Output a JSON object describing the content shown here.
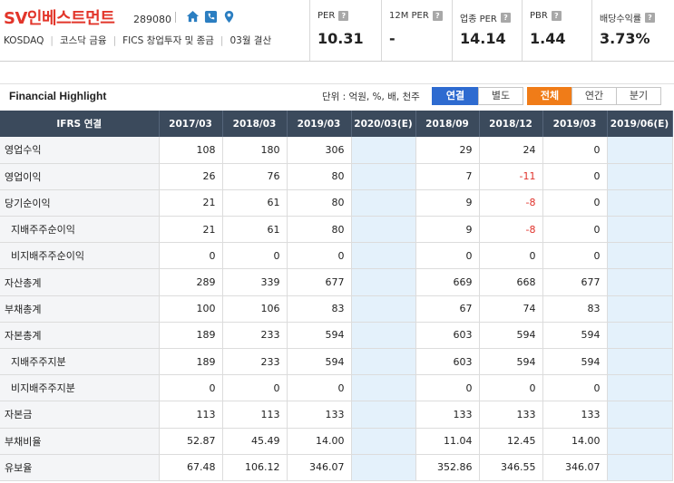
{
  "company": {
    "name": "SV인베스트먼트",
    "code": "289080",
    "market": "KOSDAQ",
    "index": "코스닥 금융",
    "fics": "FICS 창업투자 및 종금",
    "fiscal": "03월 결산"
  },
  "metrics": [
    {
      "label": "PER",
      "value": "10.31"
    },
    {
      "label": "12M PER",
      "value": "-"
    },
    {
      "label": "업종 PER",
      "value": "14.14"
    },
    {
      "label": "PBR",
      "value": "1.44"
    },
    {
      "label": "배당수익률",
      "value": "3.73%"
    }
  ],
  "help_glyph": "?",
  "toolbar": {
    "title": "Financial Highlight",
    "unit": "단위 : 억원, %, 배, 천주",
    "consolidated": "연결",
    "separate": "별도",
    "all": "전체",
    "annual": "연간",
    "quarterly": "분기"
  },
  "table": {
    "headers": [
      "IFRS 연결",
      "2017/03",
      "2018/03",
      "2019/03",
      "2020/03(E)",
      "2018/09",
      "2018/12",
      "2019/03",
      "2019/06(E)"
    ],
    "rows": [
      {
        "label": "영업수익",
        "sub": false,
        "values": [
          "108",
          "180",
          "306",
          "",
          "29",
          "24",
          "0",
          ""
        ]
      },
      {
        "label": "영업이익",
        "sub": false,
        "values": [
          "26",
          "76",
          "80",
          "",
          "7",
          "-11",
          "0",
          ""
        ]
      },
      {
        "label": "당기순이익",
        "sub": false,
        "values": [
          "21",
          "61",
          "80",
          "",
          "9",
          "-8",
          "0",
          ""
        ]
      },
      {
        "label": "지배주주순이익",
        "sub": true,
        "values": [
          "21",
          "61",
          "80",
          "",
          "9",
          "-8",
          "0",
          ""
        ]
      },
      {
        "label": "비지배주주순이익",
        "sub": true,
        "values": [
          "0",
          "0",
          "0",
          "",
          "0",
          "0",
          "0",
          ""
        ]
      },
      {
        "label": "자산총계",
        "sub": false,
        "values": [
          "289",
          "339",
          "677",
          "",
          "669",
          "668",
          "677",
          ""
        ]
      },
      {
        "label": "부채총계",
        "sub": false,
        "values": [
          "100",
          "106",
          "83",
          "",
          "67",
          "74",
          "83",
          ""
        ]
      },
      {
        "label": "자본총계",
        "sub": false,
        "values": [
          "189",
          "233",
          "594",
          "",
          "603",
          "594",
          "594",
          ""
        ]
      },
      {
        "label": "지배주주지분",
        "sub": true,
        "values": [
          "189",
          "233",
          "594",
          "",
          "603",
          "594",
          "594",
          ""
        ]
      },
      {
        "label": "비지배주주지분",
        "sub": true,
        "values": [
          "0",
          "0",
          "0",
          "",
          "0",
          "0",
          "0",
          ""
        ]
      },
      {
        "label": "자본금",
        "sub": false,
        "values": [
          "113",
          "113",
          "133",
          "",
          "133",
          "133",
          "133",
          ""
        ]
      },
      {
        "label": "부채비율",
        "sub": false,
        "values": [
          "52.87",
          "45.49",
          "14.00",
          "",
          "11.04",
          "12.45",
          "14.00",
          ""
        ]
      },
      {
        "label": "유보율",
        "sub": false,
        "values": [
          "67.48",
          "106.12",
          "346.07",
          "",
          "352.86",
          "346.55",
          "346.07",
          ""
        ]
      }
    ]
  },
  "colors": {
    "brand_red": "#e2352a",
    "header_dark": "#3b4a5c",
    "estimate_bg": "#e4f1fb",
    "accent_blue": "#2e6bd0",
    "accent_orange": "#f07c18",
    "negative": "#e0322b"
  },
  "icons": [
    "home-icon",
    "phone-icon",
    "location-pin-icon",
    "help-icon"
  ]
}
